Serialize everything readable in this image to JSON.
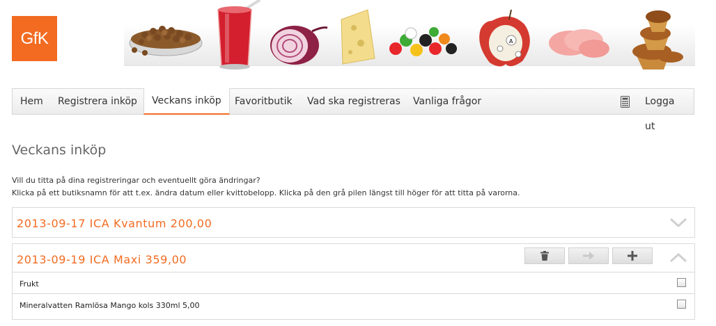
{
  "logo": {
    "text": "GfK"
  },
  "banner": {
    "items": [
      "dog-food-icon",
      "red-drink-icon",
      "red-onion-icon",
      "cheese-icon",
      "candy-icon",
      "apple-icon",
      "ham-slices-icon",
      "muffins-icon"
    ]
  },
  "nav": {
    "items": [
      {
        "label": "Hem"
      },
      {
        "label": "Registrera inköp"
      },
      {
        "label": "Veckans inköp",
        "active": true
      },
      {
        "label": "Favoritbutik"
      },
      {
        "label": "Vad ska registreras"
      },
      {
        "label": "Vanliga frågor"
      }
    ],
    "logout": "Logga ut"
  },
  "page": {
    "title": "Veckans inköp",
    "intro_line1": "Vill du titta på dina registreringar och eventuellt göra ändringar?",
    "intro_line2": "Klicka på ett butiksnamn för att t.ex. ändra datum eller kvittobelopp. Klicka på den grå pilen längst till höger för att titta på varorna."
  },
  "purchases": [
    {
      "title": "2013-09-17 ICA Kvantum 200,00",
      "expanded": false,
      "items": []
    },
    {
      "title": "2013-09-19 ICA Maxi 359,00",
      "expanded": true,
      "items": [
        {
          "label": "Frukt",
          "checked": false
        },
        {
          "label": "Mineralvatten Ramlösa Mango kols 330ml 5,00",
          "checked": false
        }
      ]
    }
  ],
  "colors": {
    "accent": "#f26b21",
    "text": "#333333",
    "border": "#d9d9d9"
  }
}
